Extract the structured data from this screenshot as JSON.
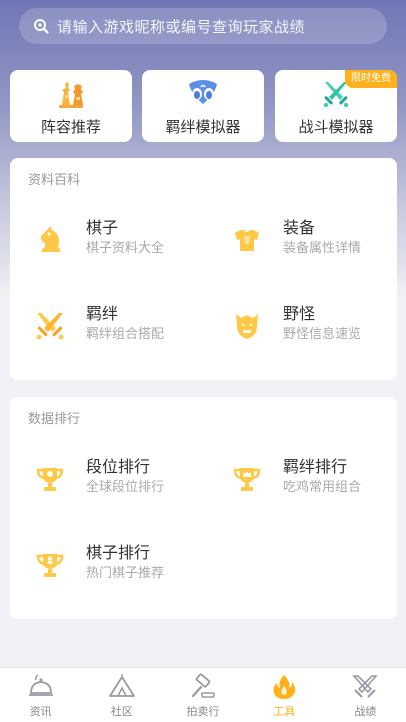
{
  "search": {
    "placeholder": "请输入游戏昵称或编号查询玩家战绩"
  },
  "tools": [
    {
      "label": "阵容推荐",
      "icon": "chess-pieces-icon"
    },
    {
      "label": "羁绊模拟器",
      "icon": "bond-simulator-icon"
    },
    {
      "label": "战斗模拟器",
      "icon": "battle-swords-icon",
      "badge": "限时免费"
    }
  ],
  "encyclopedia": {
    "title": "资料百科",
    "items": [
      {
        "name": "棋子",
        "desc": "棋子资料大全",
        "icon": "knight-icon"
      },
      {
        "name": "装备",
        "desc": "装备属性详情",
        "icon": "armor-icon"
      },
      {
        "name": "羁绊",
        "desc": "羁绊组合搭配",
        "icon": "crossed-swords-icon"
      },
      {
        "name": "野怪",
        "desc": "野怪信息速览",
        "icon": "monster-icon"
      }
    ]
  },
  "rankings": {
    "title": "数据排行",
    "items": [
      {
        "name": "段位排行",
        "desc": "全球段位排行",
        "icon": "trophy-icon"
      },
      {
        "name": "羁绊排行",
        "desc": "吃鸡常用组合",
        "icon": "trophy-crown-icon"
      },
      {
        "name": "棋子排行",
        "desc": "热门棋子推荐",
        "icon": "trophy-pawn-icon"
      }
    ]
  },
  "tabbar": {
    "items": [
      {
        "label": "资讯",
        "icon": "news-bell-icon",
        "active": false
      },
      {
        "label": "社区",
        "icon": "community-tent-icon",
        "active": false
      },
      {
        "label": "拍卖行",
        "icon": "auction-hammer-icon",
        "active": false
      },
      {
        "label": "工具",
        "icon": "tools-fire-icon",
        "active": true
      },
      {
        "label": "战绩",
        "icon": "record-swords-icon",
        "active": false
      }
    ]
  },
  "colors": {
    "accent": "#ffb11b",
    "icon_yellow": "#ffc847",
    "header": "#6f76b5"
  }
}
